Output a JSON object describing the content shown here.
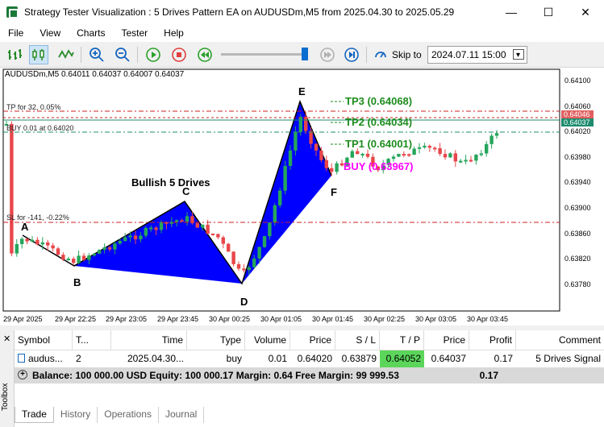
{
  "window": {
    "title": "Strategy Tester Visualization : 5 Drives Pattern EA on AUDUSDm,M5 from 2025.04.30 to 2025.05.29"
  },
  "menu": [
    "File",
    "View",
    "Charts",
    "Tester",
    "Help"
  ],
  "toolbar": {
    "skip_label": "Skip to",
    "skip_date": "2024.07.11 15:00"
  },
  "chart": {
    "symbol_info": "AUDUSDm,M5  0.64011 0.64037 0.64007 0.64037",
    "pattern_title": "Bullish 5 Drives",
    "point_labels": [
      "A",
      "B",
      "C",
      "D",
      "E",
      "F"
    ],
    "levels": {
      "tp_label": "TP for 32, 0.05%",
      "buy_label": "BUY 0.01 at 0.64020",
      "sl_label": "SL for -141, -0.22%"
    },
    "targets": {
      "tp3": "TP3 (0.64068)",
      "tp2": "TP2 (0.64034)",
      "tp1": "TP1 (0.64001)",
      "buy": "BUY (0.63967)"
    },
    "price_axis": [
      "0.64100",
      "0.64060",
      "0.64020",
      "0.63980",
      "0.63940",
      "0.63900",
      "0.63860",
      "0.63820",
      "0.63780"
    ],
    "price_tags": [
      "0.64046",
      "0.64037"
    ],
    "time_axis": [
      "29 Apr 2025",
      "29 Apr 22:25",
      "29 Apr 23:05",
      "29 Apr 23:45",
      "30 Apr 00:25",
      "30 Apr 01:05",
      "30 Apr 01:45",
      "30 Apr 02:25",
      "30 Apr 03:05",
      "30 Apr 03:45"
    ],
    "colors": {
      "pattern_fill": "#0000ff",
      "bull": "#26a65b",
      "bear": "#e8464a",
      "tp_text": "#1e8c1e",
      "buy_text": "#ff00ff",
      "level_line": "#cc2222",
      "buy_line": "#1e8c6e"
    }
  },
  "trade_table": {
    "headers": [
      "Symbol",
      "T...",
      "Time",
      "Type",
      "Volume",
      "Price",
      "S / L",
      "T / P",
      "Price",
      "Profit",
      "Comment"
    ],
    "row": {
      "symbol": "audus...",
      "ticket": "2",
      "time": "2025.04.30...",
      "type": "buy",
      "volume": "0.01",
      "price": "0.64020",
      "sl": "0.63879",
      "tp": "0.64052",
      "cur_price": "0.64037",
      "profit": "0.17",
      "comment": "5 Drives Signal"
    },
    "balance_line": "Balance: 100 000.00 USD  Equity: 100 000.17  Margin: 0.64  Free Margin: 99 999.53",
    "balance_profit": "0.17"
  },
  "toolbox": {
    "side_label": "Toolbox",
    "tabs": [
      "Trade",
      "History",
      "Operations",
      "Journal"
    ]
  }
}
